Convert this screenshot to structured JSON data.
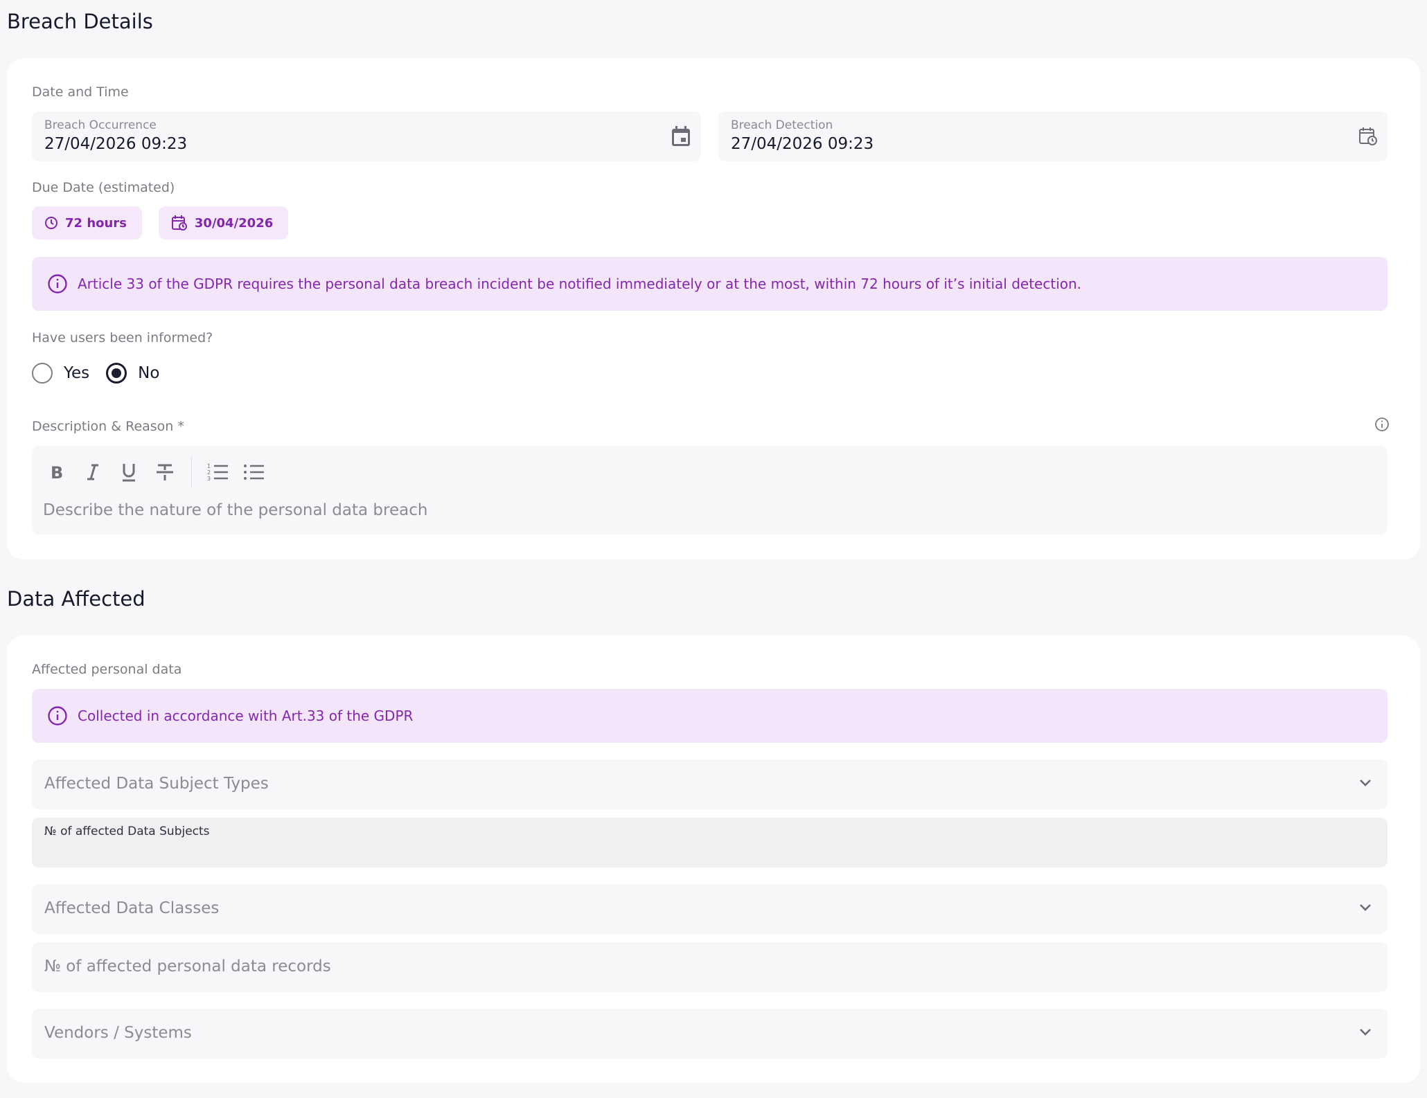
{
  "breach_details": {
    "title": "Breach Details",
    "date_time_label": "Date and Time",
    "occurrence": {
      "label": "Breach Occurrence",
      "value": "27/04/2026 09:23",
      "icon": "calendar-icon"
    },
    "detection": {
      "label": "Breach Detection",
      "value": "27/04/2026 09:23",
      "icon": "calendar-clock-icon"
    },
    "due_date_label": "Due Date (estimated)",
    "due_hours": "72 hours",
    "due_date": "30/04/2026",
    "gdpr_notice": "Article 33 of the GDPR requires the personal data breach incident be notified immediately or at the most, within 72 hours of it’s initial detection.",
    "informed_question": "Have users been informed?",
    "informed_options": [
      {
        "label": "Yes",
        "checked": false
      },
      {
        "label": "No",
        "checked": true
      }
    ],
    "description_label": "Description & Reason *",
    "description_placeholder": "Describe the nature of the personal data breach"
  },
  "data_affected": {
    "title": "Data Affected",
    "affected_label": "Affected personal data",
    "notice": "Collected in accordance with Art.33 of the GDPR",
    "subject_types_placeholder": "Affected Data Subject Types",
    "num_subjects_label": "№ of affected Data Subjects",
    "data_classes_placeholder": "Affected Data Classes",
    "num_records_placeholder": "№ of affected personal data records",
    "vendors_placeholder": "Vendors / Systems"
  },
  "colors": {
    "accent": "#8426a9",
    "accent_bg": "#f3e6fa",
    "field_bg": "#f7f7fa",
    "disabled_bg": "#f0f0f0"
  }
}
